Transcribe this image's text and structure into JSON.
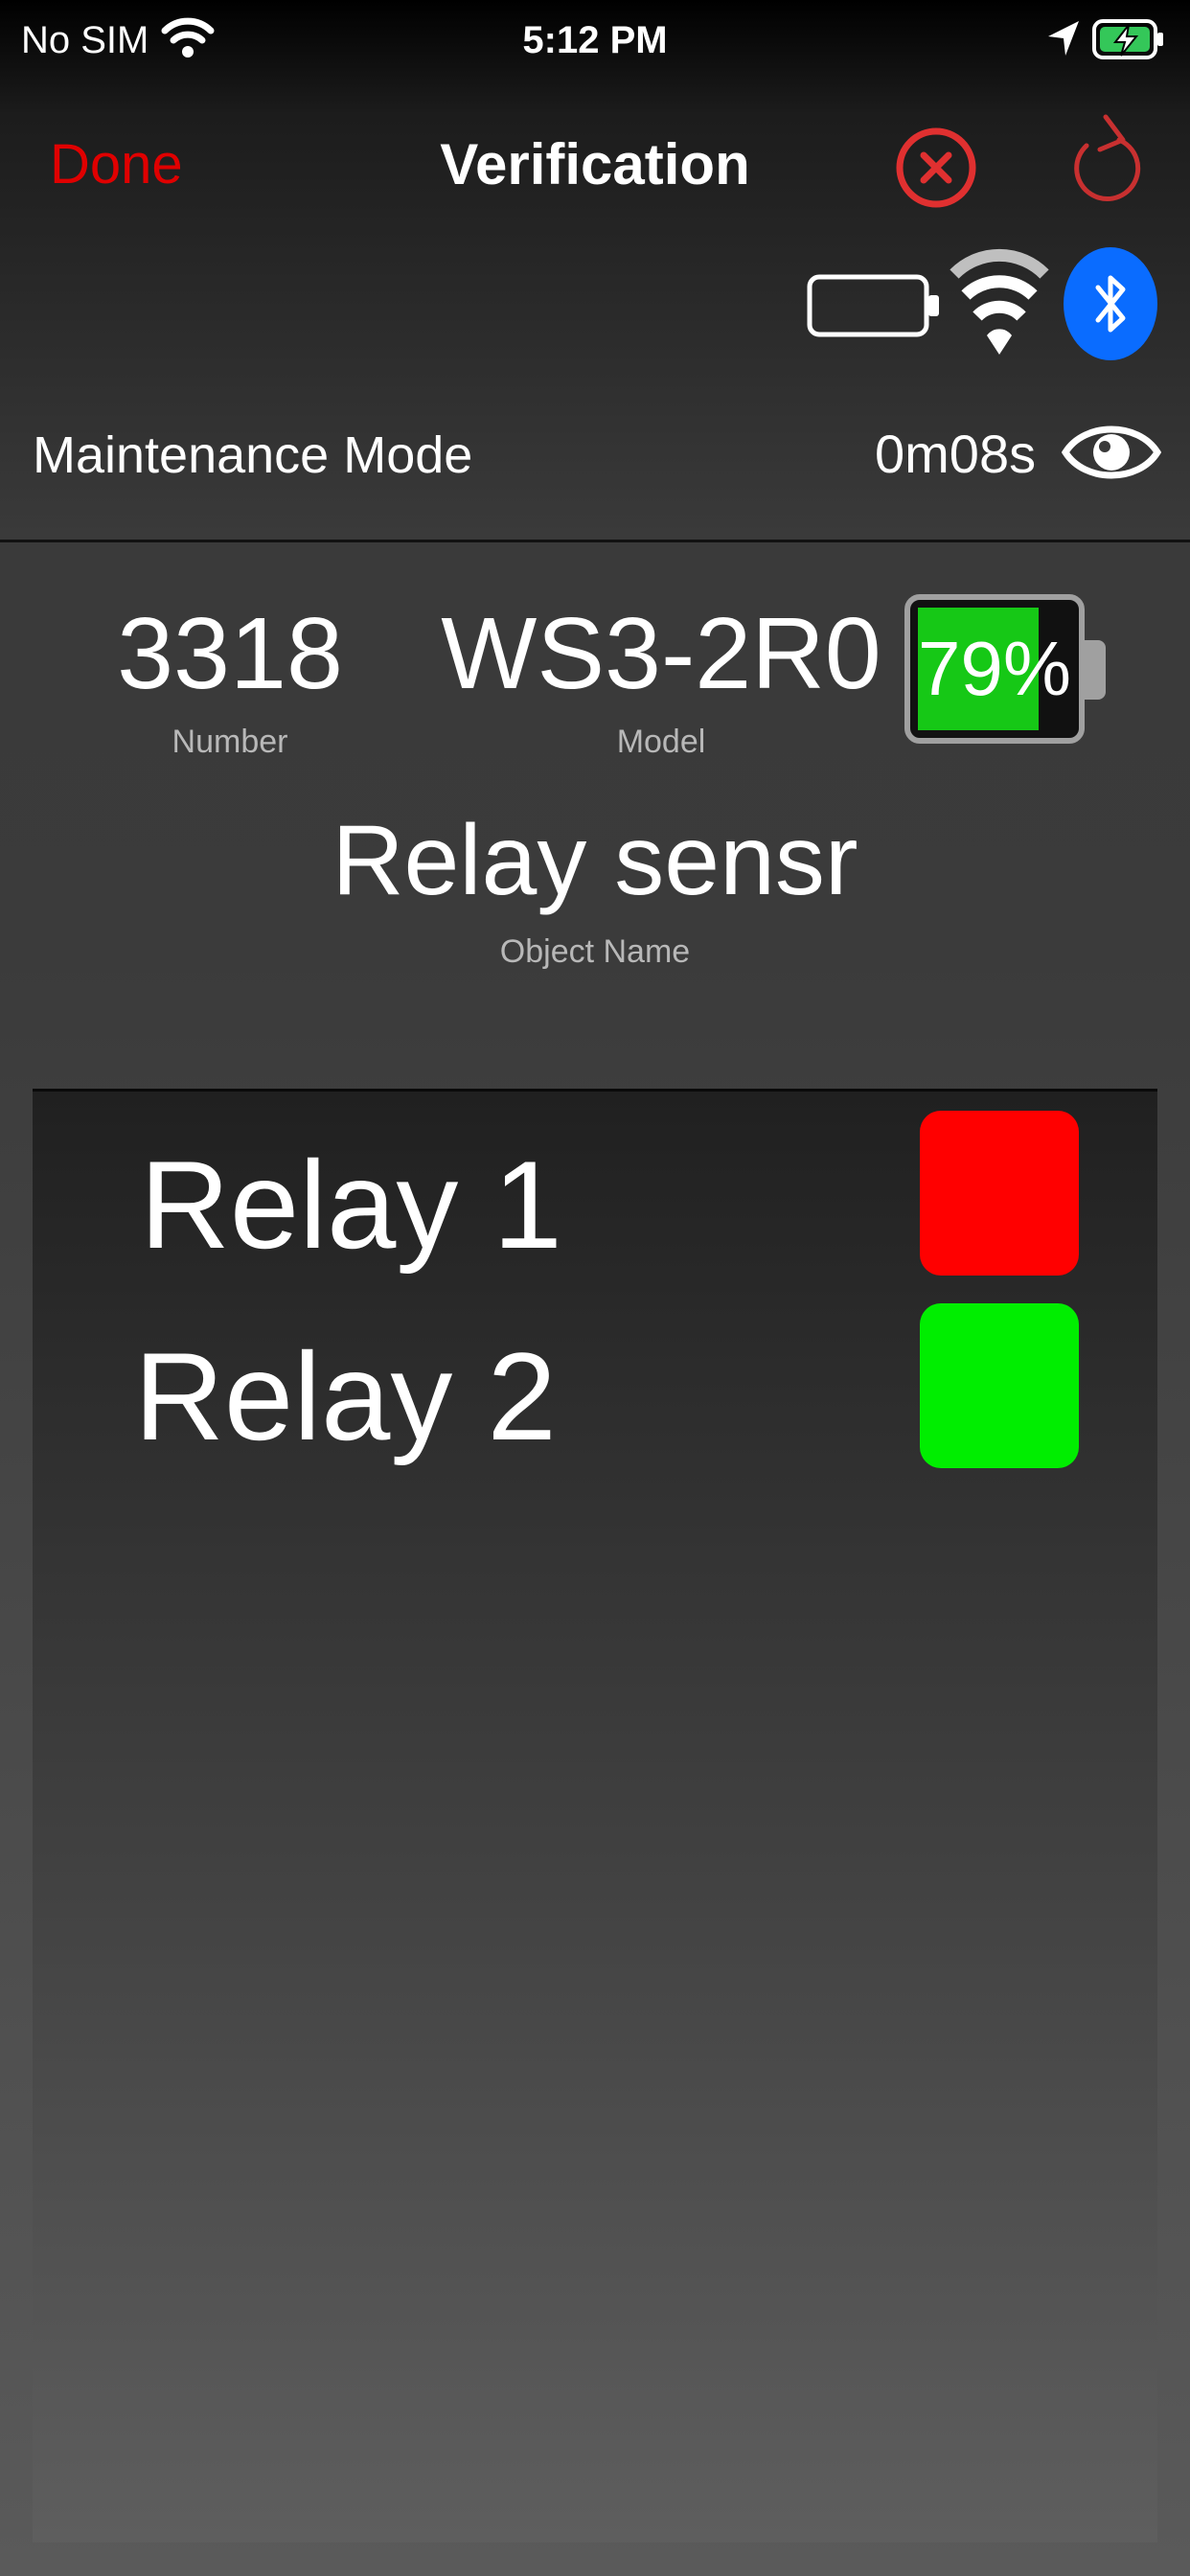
{
  "status_bar": {
    "carrier": "No SIM",
    "time": "5:12 PM",
    "icons": [
      "wifi-icon",
      "location-arrow-icon",
      "battery-charging-icon"
    ]
  },
  "nav": {
    "done_label": "Done",
    "title": "Verification",
    "icons": [
      "cancel-circle-icon",
      "refresh-icon"
    ],
    "accent_color": "#e00000"
  },
  "connectivity": {
    "icons": [
      "battery-empty-icon",
      "wifi-signal-icon",
      "bluetooth-icon"
    ]
  },
  "mode": {
    "label": "Maintenance Mode",
    "timer": "0m08s",
    "icon": "eye-icon"
  },
  "device": {
    "number_value": "3318",
    "number_caption": "Number",
    "model_value": "WS3-2R0",
    "model_caption": "Model",
    "name_value": "Relay sensr",
    "name_caption": "Object Name",
    "battery_label": "79%",
    "battery_level": 0.79,
    "battery_color": "#16c816"
  },
  "relays": [
    {
      "label": "Relay 1",
      "color": "#ff0000"
    },
    {
      "label": "Relay 2",
      "color": "#00ee00"
    }
  ]
}
